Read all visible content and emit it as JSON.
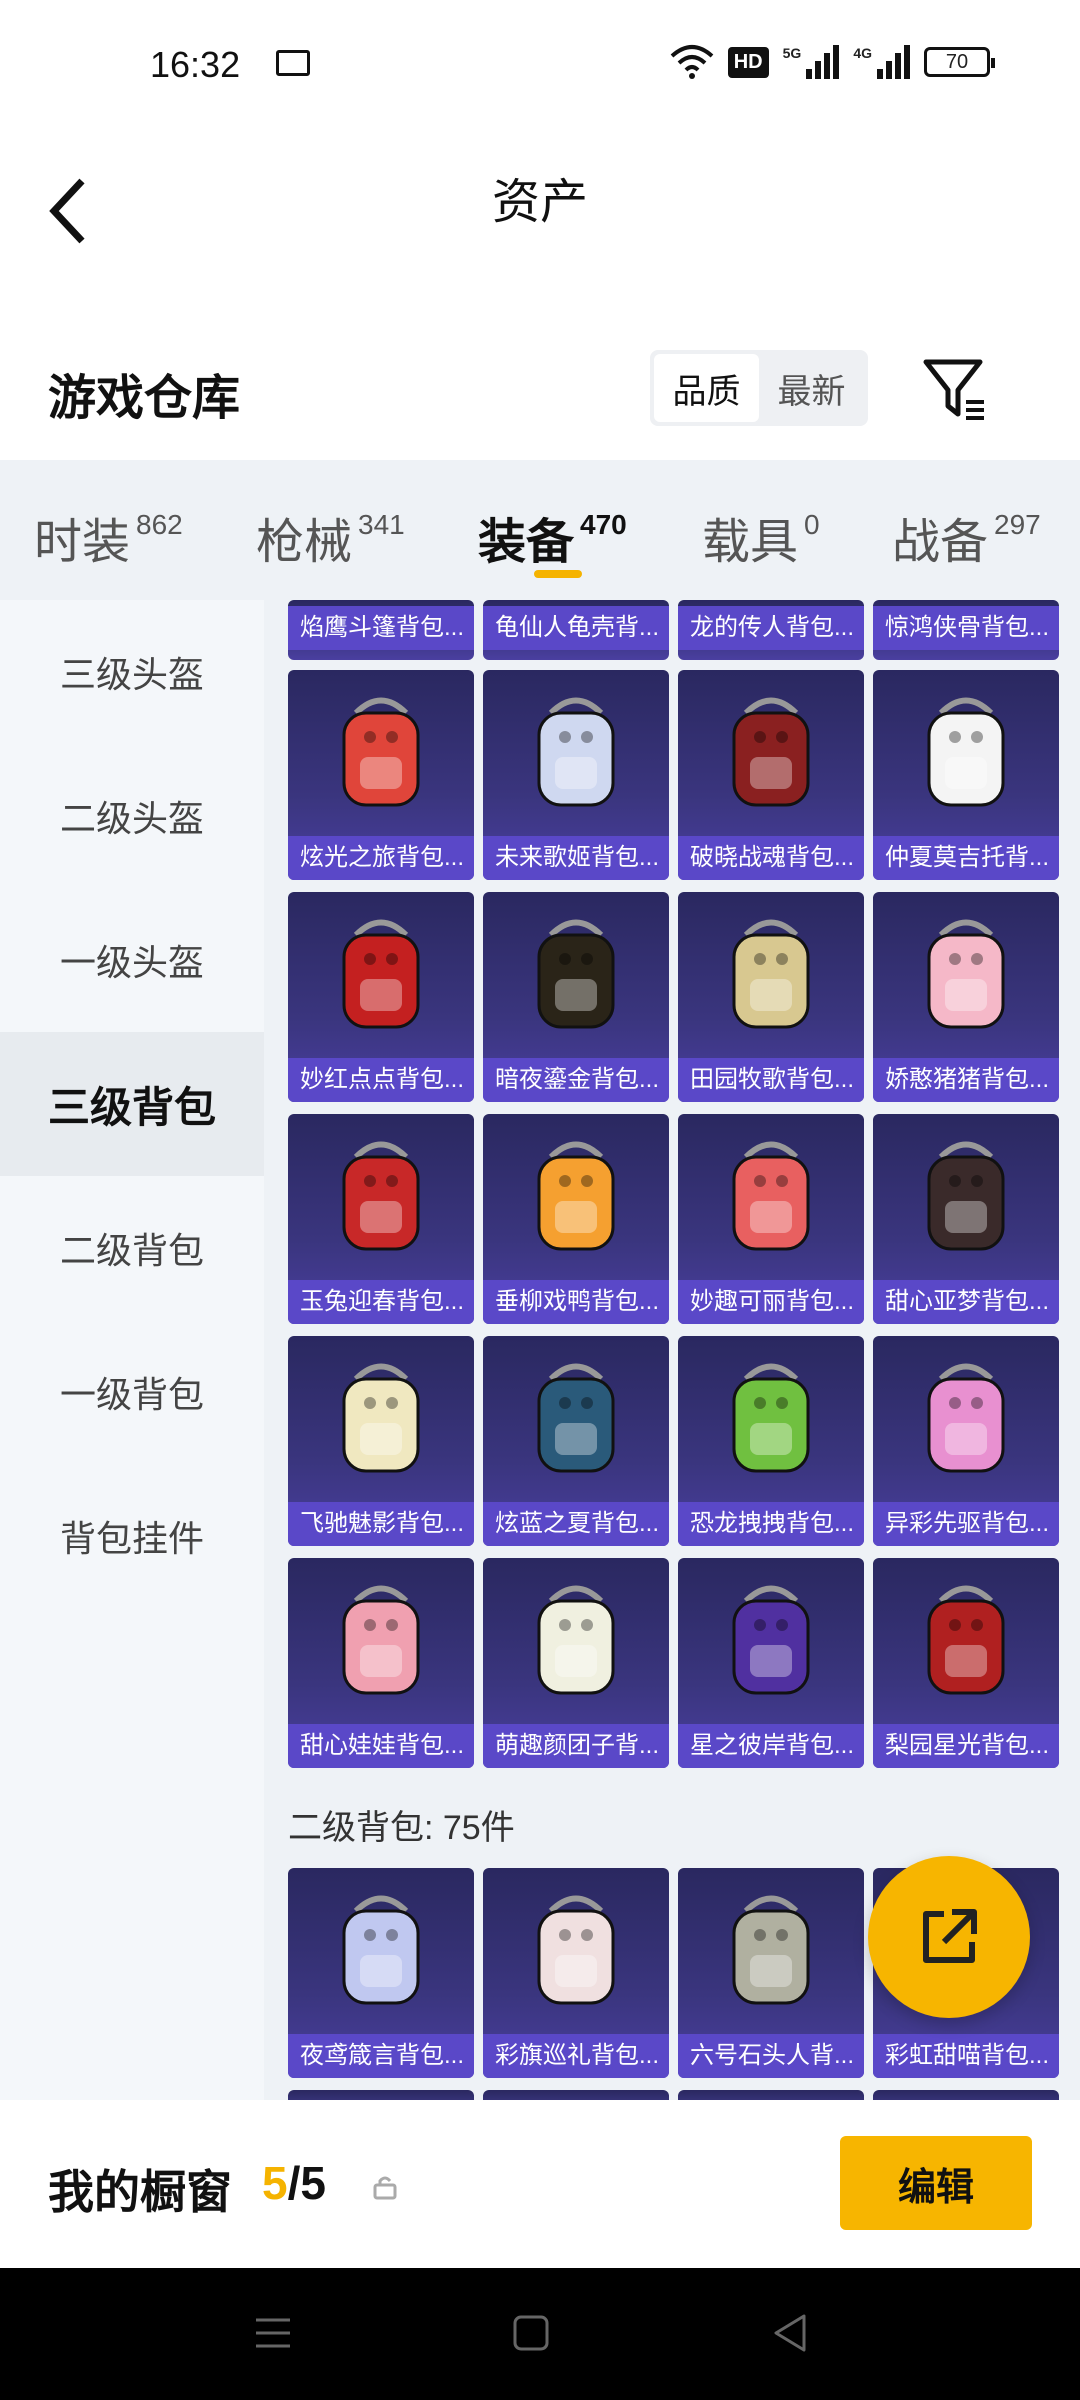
{
  "status": {
    "time": "16:32",
    "hd": "HD",
    "net1": "5G",
    "net2": "4G",
    "battery": "70"
  },
  "header": {
    "title": "资产"
  },
  "warehouse": {
    "title": "游戏仓库",
    "sort_options": [
      "品质",
      "最新"
    ],
    "active_sort": 0
  },
  "category_tabs": [
    {
      "label": "时装",
      "count": "862"
    },
    {
      "label": "枪械",
      "count": "341"
    },
    {
      "label": "装备",
      "count": "470"
    },
    {
      "label": "载具",
      "count": "0"
    },
    {
      "label": "战备",
      "count": "297"
    }
  ],
  "active_category": 2,
  "sub_categories": [
    "三级头盔",
    "二级头盔",
    "一级头盔",
    "三级背包",
    "二级背包",
    "一级背包",
    "背包挂件"
  ],
  "active_sub": 3,
  "top_partial_items": [
    "焰鹰斗篷背包...",
    "龟仙人龟壳背...",
    "龙的传人背包...",
    "惊鸿侠骨背包..."
  ],
  "items": [
    {
      "name": "炫光之旅背包...",
      "icon": "crocodile-backpack-icon",
      "color": "#e0453a"
    },
    {
      "name": "未来歌姬背包...",
      "icon": "singer-backpack-icon",
      "color": "#cfd8f0"
    },
    {
      "name": "破晓战魂背包...",
      "icon": "warrior-backpack-icon",
      "color": "#8a2020"
    },
    {
      "name": "仲夏莫吉托背...",
      "icon": "mojito-backpack-icon",
      "color": "#f4f4f4"
    },
    {
      "name": "妙红点点背包...",
      "icon": "ladybug-backpack-icon",
      "color": "#c42020"
    },
    {
      "name": "暗夜鎏金背包...",
      "icon": "gold-night-backpack-icon",
      "color": "#2a2418"
    },
    {
      "name": "田园牧歌背包...",
      "icon": "basket-backpack-icon",
      "color": "#d8c890"
    },
    {
      "name": "娇憨猪猪背包...",
      "icon": "pig-backpack-icon",
      "color": "#f5b8c8"
    },
    {
      "name": "玉兔迎春背包...",
      "icon": "rabbit-backpack-icon",
      "color": "#c82828"
    },
    {
      "name": "垂柳戏鸭背包...",
      "icon": "duck-backpack-icon",
      "color": "#f5a030"
    },
    {
      "name": "妙趣可丽背包...",
      "icon": "crepe-backpack-icon",
      "color": "#e86060"
    },
    {
      "name": "甜心亚梦背包...",
      "icon": "dream-backpack-icon",
      "color": "#3a2a2a"
    },
    {
      "name": "飞驰魅影背包...",
      "icon": "racer-backpack-icon",
      "color": "#f0e8c0"
    },
    {
      "name": "炫蓝之夏背包...",
      "icon": "blue-summer-backpack-icon",
      "color": "#2a5a7a"
    },
    {
      "name": "恐龙拽拽背包...",
      "icon": "dino-backpack-icon",
      "color": "#70c040"
    },
    {
      "name": "异彩先驱背包...",
      "icon": "colorful-backpack-icon",
      "color": "#e890d0"
    },
    {
      "name": "甜心娃娃背包...",
      "icon": "doll-backpack-icon",
      "color": "#f0a0b0"
    },
    {
      "name": "萌趣颜团子背...",
      "icon": "dumpling-backpack-icon",
      "color": "#f0f0e0"
    },
    {
      "name": "星之彼岸背包...",
      "icon": "astronaut-backpack-icon",
      "color": "#5030a0"
    },
    {
      "name": "梨园星光背包...",
      "icon": "opera-backpack-icon",
      "color": "#b02020"
    }
  ],
  "section2": {
    "label": "二级背包: 75件"
  },
  "items2": [
    {
      "name": "夜鸢箴言背包...",
      "icon": "night-kite-backpack-icon",
      "color": "#c0c8f0"
    },
    {
      "name": "彩旗巡礼背包...",
      "icon": "flag-backpack-icon",
      "color": "#f0e0e0"
    },
    {
      "name": "六号石头人背...",
      "icon": "stone-backpack-icon",
      "color": "#b0b0a0"
    },
    {
      "name": "彩虹甜喵背包...",
      "icon": "cat-backpack-icon",
      "color": "#f0c0a0"
    }
  ],
  "showcase": {
    "title": "我的橱窗",
    "current": "5",
    "slash": "/",
    "total": "5",
    "edit_label": "编辑"
  }
}
